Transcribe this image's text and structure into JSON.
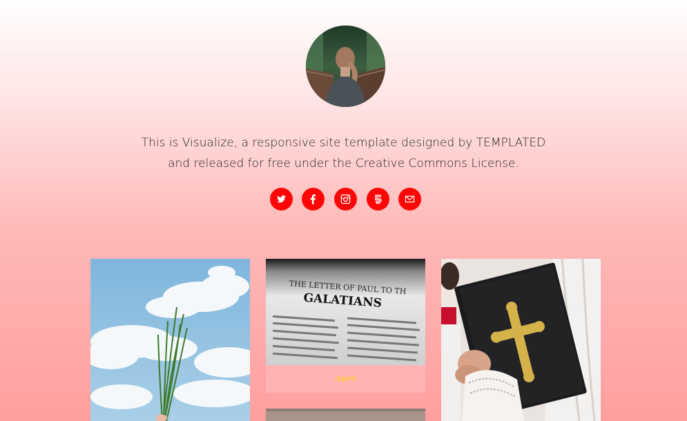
{
  "intro": {
    "line1": "This is Visualize, a responsive site template designed by TEMPLATED",
    "line2": "and released for free under the Creative Commons License."
  },
  "social": [
    {
      "name": "twitter-icon"
    },
    {
      "name": "facebook-icon"
    },
    {
      "name": "instagram-icon"
    },
    {
      "name": "500px-icon"
    },
    {
      "name": "envelope-icon"
    }
  ],
  "gallery": {
    "card2": {
      "heading_line1": "THE LETTER OF PAUL TO TH",
      "heading_line2": "GALATIANS",
      "caption": "/spirit"
    }
  },
  "colors": {
    "accent": "#ff0505",
    "caption_text": "#ffd400",
    "caption_bg": "#ffb3b3"
  }
}
